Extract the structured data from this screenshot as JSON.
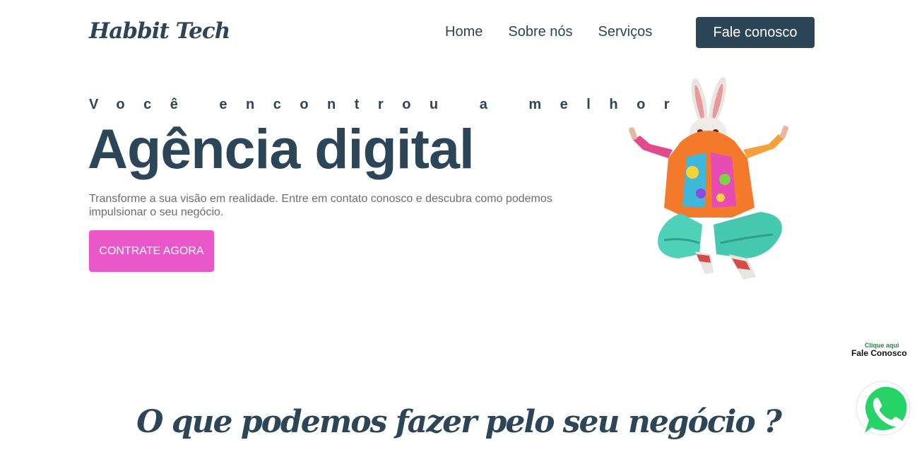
{
  "header": {
    "logo": "Habbit Tech",
    "nav": [
      {
        "label": "Home"
      },
      {
        "label": "Sobre nós"
      },
      {
        "label": "Serviços"
      }
    ],
    "cta_label": "Fale conosco"
  },
  "hero": {
    "eyebrow": "Você encontrou a melhor",
    "title": "Agência digital",
    "description": "Transforme a sua visão em realidade. Entre em contato conosco e descubra como podemos impulsionar o seu negócio.",
    "cta_label": "CONTRATE AGORA",
    "image_icon": "rabbit-dancer-illustration"
  },
  "section": {
    "title": "O que podemos fazer pelo seu negócio ?"
  },
  "whatsapp": {
    "small_label": "Clique aqui",
    "big_label": "Fale Conosco",
    "icon": "whatsapp-icon"
  },
  "colors": {
    "primary": "#2c4557",
    "accent": "#ea57c8",
    "text_muted": "#6d6d6d",
    "whatsapp": "#25d366"
  }
}
